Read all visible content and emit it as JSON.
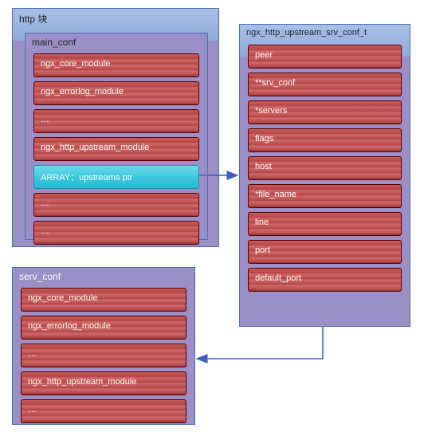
{
  "http_block": {
    "title": "http 块",
    "main_conf": {
      "title": "main_conf",
      "items": [
        "ngx_core_module",
        "ngx_errorlog_module",
        "…",
        "ngx_http_upstream_module",
        "ARRAY：upstreams ptr",
        "…",
        "…"
      ],
      "highlight_index": 4
    }
  },
  "serv_conf": {
    "title": "serv_conf",
    "items": [
      "ngx_core_module",
      "ngx_errorlog_module",
      "…",
      "ngx_http_upstream_module",
      "…"
    ]
  },
  "upstream_srv_conf": {
    "title": "ngx_http_upstream_srv_conf_t",
    "items": [
      "peer",
      "**srv_conf",
      "*servers",
      "flags",
      "host",
      "*file_name",
      "line",
      "port",
      "default_port"
    ]
  }
}
